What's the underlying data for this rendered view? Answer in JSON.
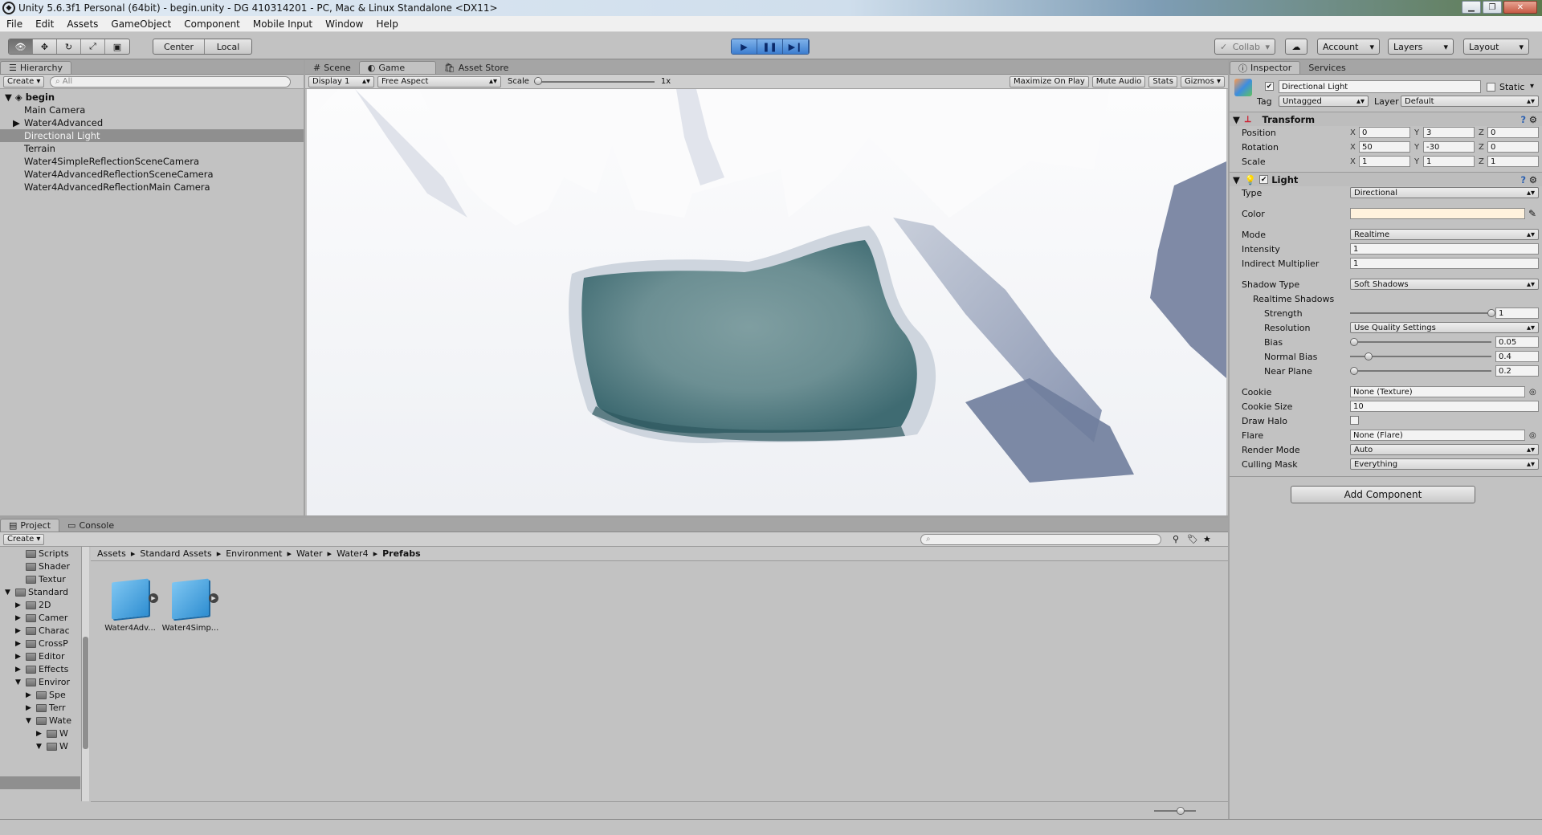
{
  "window": {
    "title": "Unity 5.6.3f1 Personal (64bit) - begin.unity - DG  410314201 - PC, Mac & Linux Standalone <DX11>"
  },
  "menu": [
    "File",
    "Edit",
    "Assets",
    "GameObject",
    "Component",
    "Mobile Input",
    "Window",
    "Help"
  ],
  "toolbar": {
    "pivot": "Center",
    "space": "Local",
    "collab": "Collab",
    "account": "Account",
    "layers": "Layers",
    "layout": "Layout"
  },
  "hierarchy": {
    "tab": "Hierarchy",
    "create": "Create",
    "search_placeholder": "All",
    "scene": "begin",
    "items": [
      "Main Camera",
      "Water4Advanced",
      "Directional Light",
      "Terrain",
      "Water4SimpleReflectionSceneCamera",
      "Water4AdvancedReflectionSceneCamera",
      "Water4AdvancedReflectionMain Camera"
    ],
    "selected": "Directional Light"
  },
  "game": {
    "tabs": [
      "Scene",
      "Game",
      "Asset Store"
    ],
    "active_tab": "Game",
    "display": "Display 1",
    "aspect": "Free Aspect",
    "scale_label": "Scale",
    "scale_value": "1x",
    "options": [
      "Maximize On Play",
      "Mute Audio",
      "Stats",
      "Gizmos"
    ]
  },
  "inspector": {
    "tabs": [
      "Inspector",
      "Services"
    ],
    "object_name": "Directional Light",
    "static_label": "Static",
    "tag_label": "Tag",
    "tag_value": "Untagged",
    "layer_label": "Layer",
    "layer_value": "Default",
    "transform": {
      "title": "Transform",
      "position": {
        "label": "Position",
        "x": "0",
        "y": "3",
        "z": "0"
      },
      "rotation": {
        "label": "Rotation",
        "x": "50",
        "y": "-30",
        "z": "0"
      },
      "scale": {
        "label": "Scale",
        "x": "1",
        "y": "1",
        "z": "1"
      }
    },
    "light": {
      "title": "Light",
      "type_label": "Type",
      "type_value": "Directional",
      "color_label": "Color",
      "color_value": "#fff2dd",
      "mode_label": "Mode",
      "mode_value": "Realtime",
      "intensity_label": "Intensity",
      "intensity_value": "1",
      "indirect_label": "Indirect Multiplier",
      "indirect_value": "1",
      "shadow_type_label": "Shadow Type",
      "shadow_type_value": "Soft Shadows",
      "realtime_shadows_label": "Realtime Shadows",
      "strength_label": "Strength",
      "strength_value": "1",
      "resolution_label": "Resolution",
      "resolution_value": "Use Quality Settings",
      "bias_label": "Bias",
      "bias_value": "0.05",
      "normal_bias_label": "Normal Bias",
      "normal_bias_value": "0.4",
      "near_plane_label": "Near Plane",
      "near_plane_value": "0.2",
      "cookie_label": "Cookie",
      "cookie_value": "None (Texture)",
      "cookie_size_label": "Cookie Size",
      "cookie_size_value": "10",
      "draw_halo_label": "Draw Halo",
      "flare_label": "Flare",
      "flare_value": "None (Flare)",
      "render_mode_label": "Render Mode",
      "render_mode_value": "Auto",
      "culling_label": "Culling Mask",
      "culling_value": "Everything"
    },
    "add_component": "Add Component"
  },
  "project": {
    "tabs": [
      "Project",
      "Console"
    ],
    "create": "Create",
    "breadcrumb": [
      "Assets",
      "Standard Assets",
      "Environment",
      "Water",
      "Water4",
      "Prefabs"
    ],
    "tree": [
      {
        "label": "Scripts",
        "indent": 2,
        "arrow": ""
      },
      {
        "label": "Shader",
        "indent": 2,
        "arrow": ""
      },
      {
        "label": "Textur",
        "indent": 2,
        "arrow": ""
      },
      {
        "label": "Standard",
        "indent": 1,
        "arrow": "open"
      },
      {
        "label": "2D",
        "indent": 2,
        "arrow": "closed"
      },
      {
        "label": "Camer",
        "indent": 2,
        "arrow": "closed"
      },
      {
        "label": "Charac",
        "indent": 2,
        "arrow": "closed"
      },
      {
        "label": "CrossP",
        "indent": 2,
        "arrow": "closed"
      },
      {
        "label": "Editor",
        "indent": 2,
        "arrow": "closed"
      },
      {
        "label": "Effects",
        "indent": 2,
        "arrow": "closed"
      },
      {
        "label": "Enviror",
        "indent": 2,
        "arrow": "open"
      },
      {
        "label": "Spe",
        "indent": 3,
        "arrow": "closed"
      },
      {
        "label": "Terr",
        "indent": 3,
        "arrow": "closed"
      },
      {
        "label": "Wate",
        "indent": 3,
        "arrow": "open"
      },
      {
        "label": "W",
        "indent": 4,
        "arrow": "closed"
      },
      {
        "label": "W",
        "indent": 4,
        "arrow": "open"
      }
    ],
    "assets": [
      "Water4Adv...",
      "Water4Simp..."
    ]
  }
}
